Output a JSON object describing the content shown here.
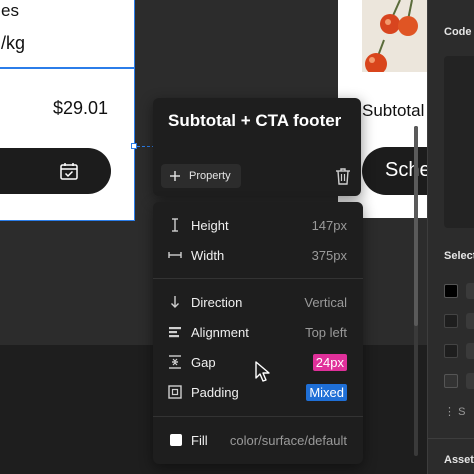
{
  "canvas": {
    "left_frame": {
      "title_fragment": "es",
      "price_unit": "/kg",
      "total": "$29.01"
    },
    "right_frame": {
      "subtotal_label": "Subtotal",
      "cta_label": "Sche"
    }
  },
  "header_popup": {
    "title": "Subtotal + CTA footer",
    "property_button": "Property"
  },
  "properties": {
    "height": {
      "label": "Height",
      "value": "147px"
    },
    "width": {
      "label": "Width",
      "value": "375px"
    },
    "direction": {
      "label": "Direction",
      "value": "Vertical"
    },
    "alignment": {
      "label": "Alignment",
      "value": "Top left"
    },
    "gap": {
      "label": "Gap",
      "value": "24px",
      "badge_color": "#e0309a"
    },
    "padding": {
      "label": "Padding",
      "value": "Mixed",
      "badge_color": "#1f6fd6"
    },
    "fill": {
      "label": "Fill",
      "value": "color/surface/default",
      "swatch_color": "#ffffff"
    }
  },
  "inspector": {
    "code_label": "Code",
    "select_label": "Select",
    "more_label": "S",
    "assets_label": "Assets",
    "swatches": [
      "#000000",
      "#1e1e1e",
      "#1e1e1e",
      "#333333"
    ]
  },
  "colors": {
    "selection": "#2b7de9",
    "popup_bg": "#1e1e1e",
    "canvas_bg": "#2c2c2c"
  },
  "icons": [
    "calendar-check-icon",
    "plus-icon",
    "trash-icon",
    "height-icon",
    "width-icon",
    "arrow-down-icon",
    "align-left-icon",
    "gap-icon",
    "padding-icon",
    "cursor-pointer-icon"
  ]
}
